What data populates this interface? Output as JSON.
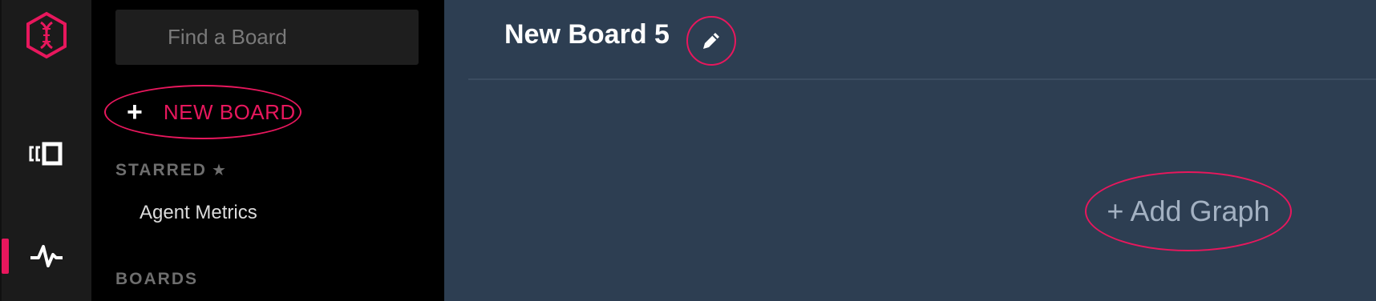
{
  "sidebar": {
    "logo_icon": "hexagon-dna-icon",
    "nav_icons": [
      "dashboards-icon",
      "activity-pulse-icon"
    ],
    "accent_color": "#e8175d"
  },
  "panel": {
    "search": {
      "placeholder": "Find a Board",
      "value": ""
    },
    "new_board_label": "NEW BOARD",
    "starred_label": "STARRED",
    "starred_items": [
      "Agent Metrics"
    ],
    "boards_label": "BOARDS"
  },
  "main": {
    "title": "New Board 5",
    "add_graph_label": "+ Add Graph"
  }
}
